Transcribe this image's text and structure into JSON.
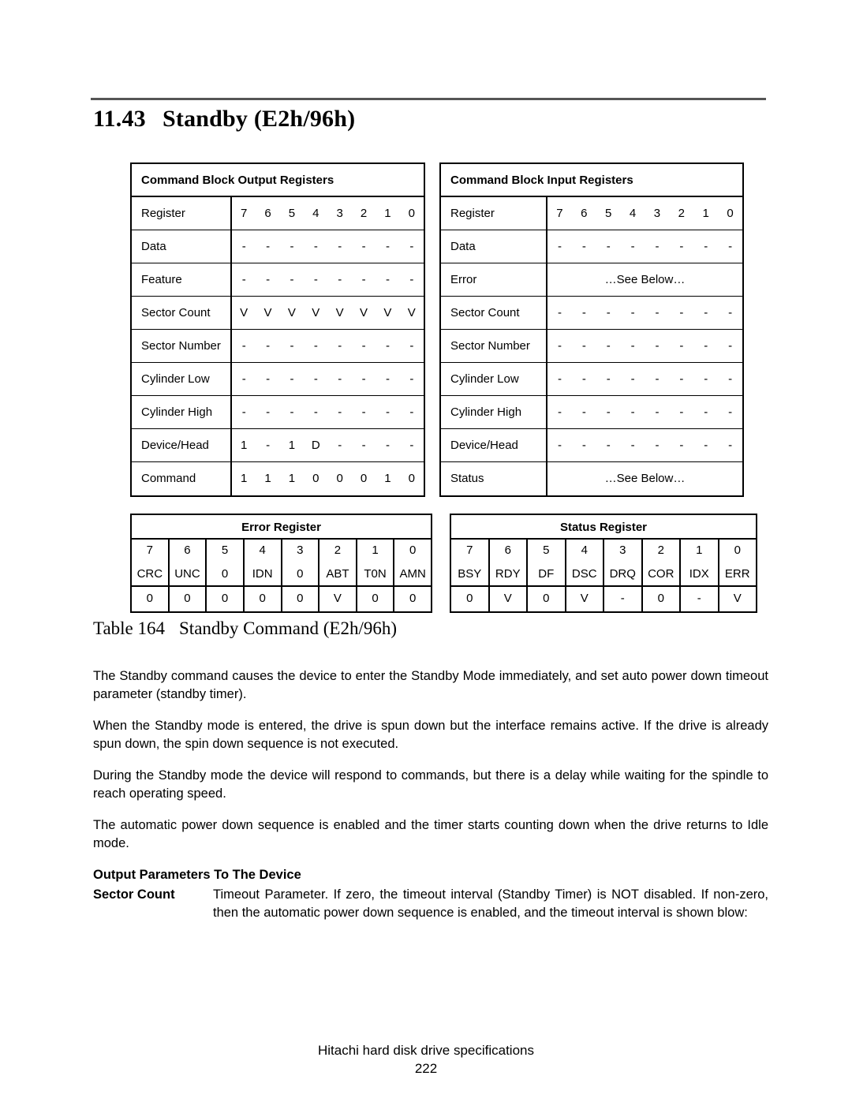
{
  "section": {
    "number": "11.43",
    "title": "Standby (E2h/96h)"
  },
  "output_registers": {
    "caption": "Command Block Output Registers",
    "rows": [
      {
        "label": "Register",
        "bits": [
          "7",
          "6",
          "5",
          "4",
          "3",
          "2",
          "1",
          "0"
        ]
      },
      {
        "label": "Data",
        "bits": [
          "-",
          "-",
          "-",
          "-",
          "-",
          "-",
          "-",
          "-"
        ]
      },
      {
        "label": "Feature",
        "bits": [
          "-",
          "-",
          "-",
          "-",
          "-",
          "-",
          "-",
          "-"
        ]
      },
      {
        "label": "Sector Count",
        "bits": [
          "V",
          "V",
          "V",
          "V",
          "V",
          "V",
          "V",
          "V"
        ]
      },
      {
        "label": "Sector Number",
        "bits": [
          "-",
          "-",
          "-",
          "-",
          "-",
          "-",
          "-",
          "-"
        ]
      },
      {
        "label": "Cylinder Low",
        "bits": [
          "-",
          "-",
          "-",
          "-",
          "-",
          "-",
          "-",
          "-"
        ]
      },
      {
        "label": "Cylinder High",
        "bits": [
          "-",
          "-",
          "-",
          "-",
          "-",
          "-",
          "-",
          "-"
        ]
      },
      {
        "label": "Device/Head",
        "bits": [
          "1",
          "-",
          "1",
          "D",
          "-",
          "-",
          "-",
          "-"
        ]
      },
      {
        "label": "Command",
        "bits": [
          "1",
          "1",
          "1",
          "0",
          "0",
          "0",
          "1",
          "0"
        ]
      }
    ]
  },
  "input_registers": {
    "caption": "Command Block Input Registers",
    "rows": [
      {
        "label": "Register",
        "bits": [
          "7",
          "6",
          "5",
          "4",
          "3",
          "2",
          "1",
          "0"
        ]
      },
      {
        "label": "Data",
        "bits": [
          "-",
          "-",
          "-",
          "-",
          "-",
          "-",
          "-",
          "-"
        ]
      },
      {
        "label": "Error",
        "span": "…See Below…"
      },
      {
        "label": "Sector Count",
        "bits": [
          "-",
          "-",
          "-",
          "-",
          "-",
          "-",
          "-",
          "-"
        ]
      },
      {
        "label": "Sector Number",
        "bits": [
          "-",
          "-",
          "-",
          "-",
          "-",
          "-",
          "-",
          "-"
        ]
      },
      {
        "label": "Cylinder Low",
        "bits": [
          "-",
          "-",
          "-",
          "-",
          "-",
          "-",
          "-",
          "-"
        ]
      },
      {
        "label": "Cylinder High",
        "bits": [
          "-",
          "-",
          "-",
          "-",
          "-",
          "-",
          "-",
          "-"
        ]
      },
      {
        "label": "Device/Head",
        "bits": [
          "-",
          "-",
          "-",
          "-",
          "-",
          "-",
          "-",
          "-"
        ]
      },
      {
        "label": "Status",
        "span": "…See Below…"
      }
    ]
  },
  "error_register": {
    "title": "Error Register",
    "bit_numbers": [
      "7",
      "6",
      "5",
      "4",
      "3",
      "2",
      "1",
      "0"
    ],
    "bit_names": [
      "CRC",
      "UNC",
      "0",
      "IDN",
      "0",
      "ABT",
      "T0N",
      "AMN"
    ],
    "bit_values": [
      "0",
      "0",
      "0",
      "0",
      "0",
      "V",
      "0",
      "0"
    ]
  },
  "status_register": {
    "title": "Status Register",
    "bit_numbers": [
      "7",
      "6",
      "5",
      "4",
      "3",
      "2",
      "1",
      "0"
    ],
    "bit_names": [
      "BSY",
      "RDY",
      "DF",
      "DSC",
      "DRQ",
      "COR",
      "IDX",
      "ERR"
    ],
    "bit_values": [
      "0",
      "V",
      "0",
      "V",
      "-",
      "0",
      "-",
      "V"
    ]
  },
  "table_caption": {
    "number": "Table 164",
    "text": "Standby Command (E2h/96h)"
  },
  "body": {
    "paragraph_1": "The Standby command causes the device to enter the Standby Mode immediately, and set auto power down timeout parameter (standby timer).",
    "paragraph_2": "When the Standby mode is entered, the drive is spun down but the interface remains active. If the drive is already spun down, the spin down sequence is not executed.",
    "paragraph_3": "During the Standby mode the device will respond to commands, but there is a delay while waiting for the spindle to reach operating speed.",
    "paragraph_4": "The automatic power down sequence is enabled and the timer starts counting down when the drive returns to Idle mode.",
    "subheading": "Output Parameters To The Device",
    "param_name": "Sector Count",
    "param_desc": "Timeout Parameter. If zero, the timeout interval (Standby Timer) is NOT disabled. If non-zero, then the automatic power down sequence is enabled, and the timeout interval is shown blow:"
  },
  "footer": {
    "text": "Hitachi hard disk drive specifications",
    "page": "222"
  }
}
